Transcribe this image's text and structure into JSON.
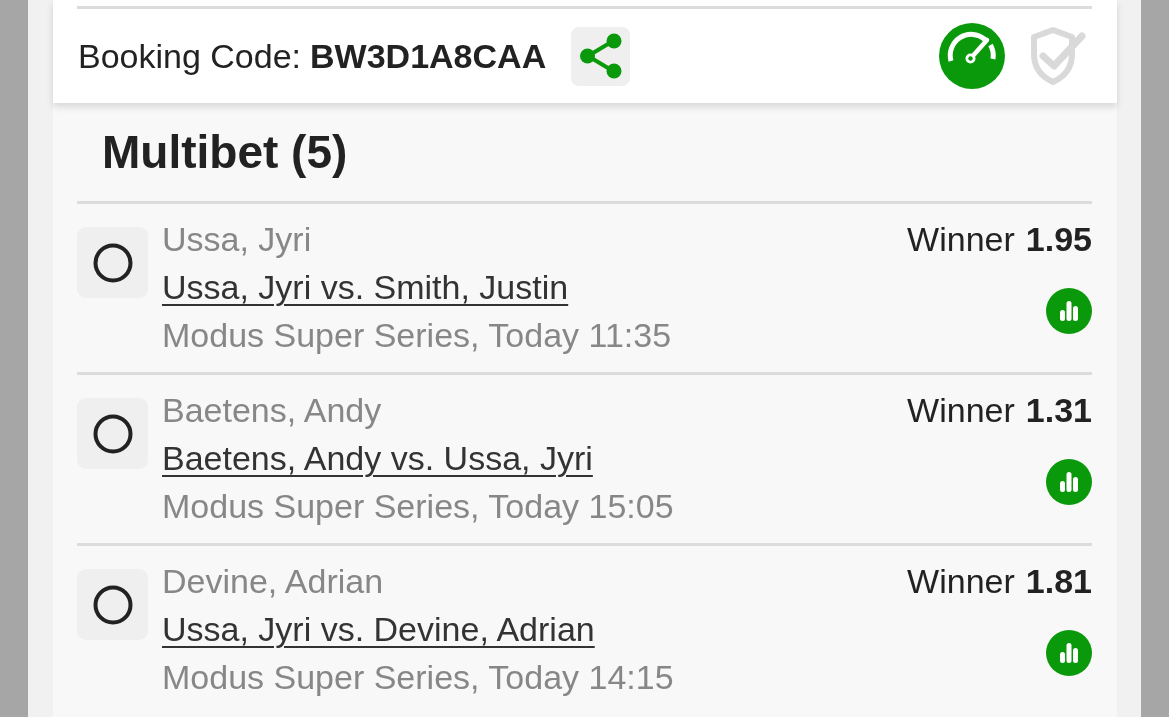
{
  "booking": {
    "label": "Booking Code:",
    "code": "BW3D1A8CAA"
  },
  "section": {
    "title": "Multibet (5)"
  },
  "bets": [
    {
      "selected": false,
      "pick": "Ussa, Jyri",
      "match": "Ussa, Jyri vs. Smith, Justin",
      "event": "Modus Super Series, Today 11:35",
      "market": "Winner",
      "odds": "1.95"
    },
    {
      "selected": false,
      "pick": "Baetens, Andy",
      "match": "Baetens, Andy vs. Ussa, Jyri",
      "event": "Modus Super Series, Today 15:05",
      "market": "Winner",
      "odds": "1.31"
    },
    {
      "selected": false,
      "pick": "Devine, Adrian",
      "match": "Ussa, Jyri vs. Devine, Adrian",
      "event": "Modus Super Series, Today 14:15",
      "market": "Winner",
      "odds": "1.81"
    }
  ]
}
